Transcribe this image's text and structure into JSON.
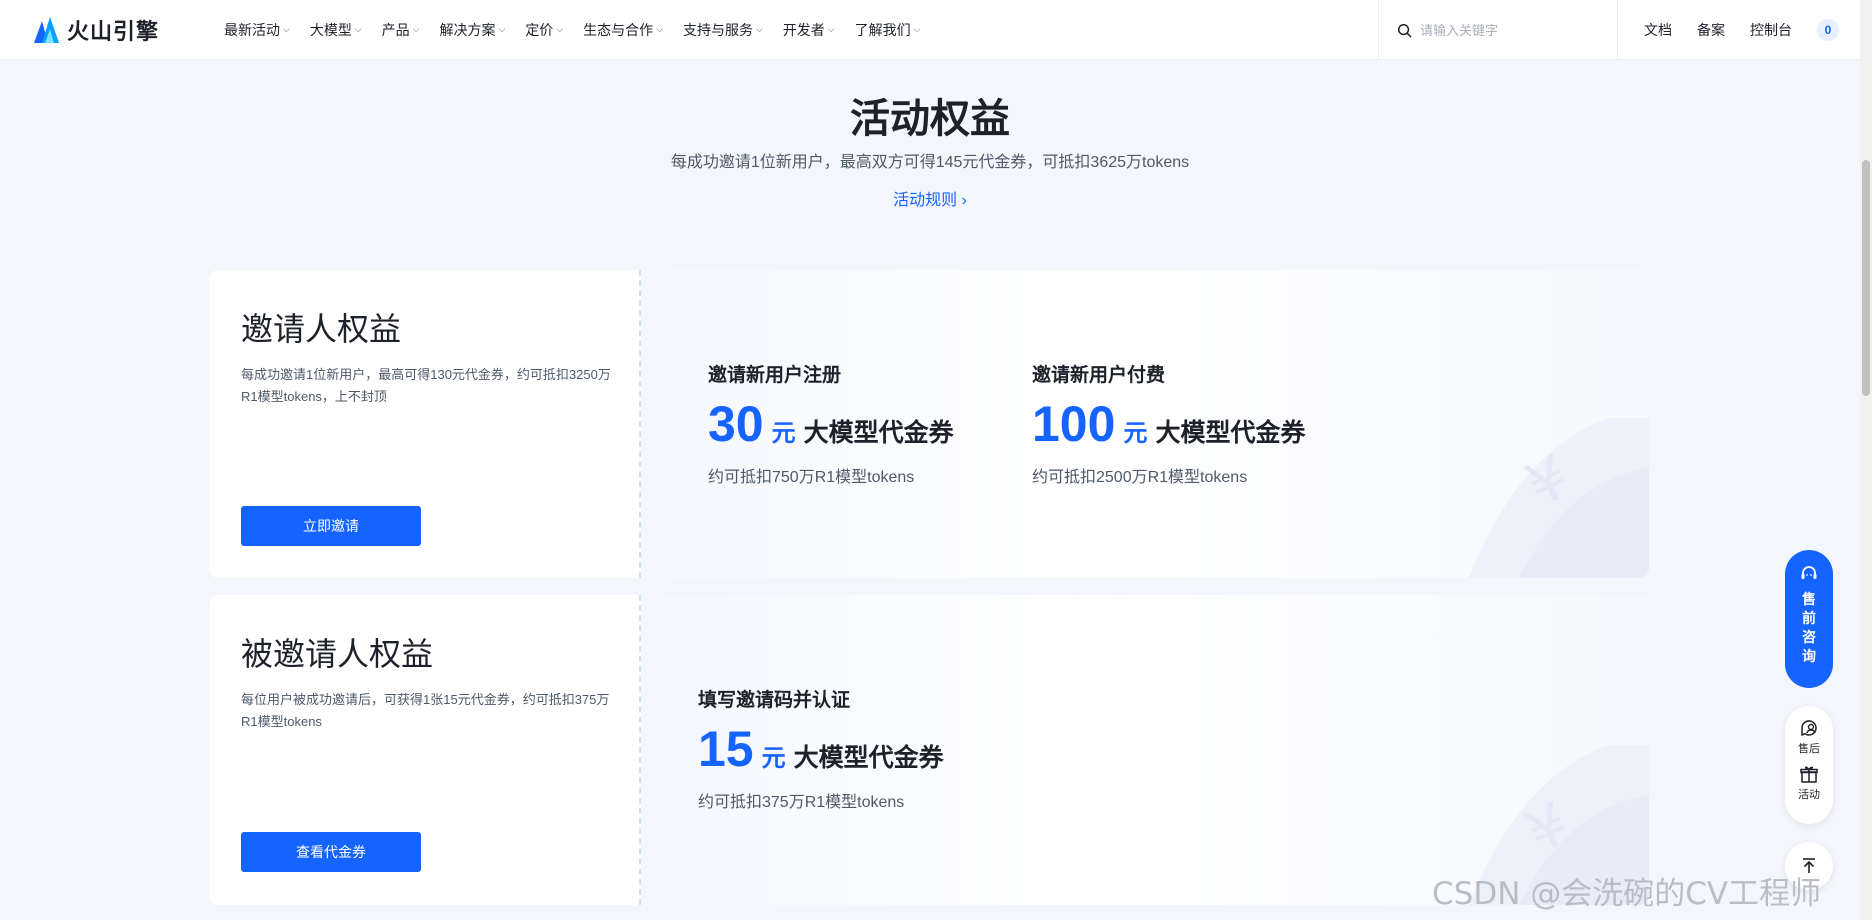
{
  "logo": {
    "text": "火山引擎"
  },
  "nav": [
    {
      "label": "最新活动"
    },
    {
      "label": "大模型"
    },
    {
      "label": "产品"
    },
    {
      "label": "解决方案"
    },
    {
      "label": "定价"
    },
    {
      "label": "生态与合作"
    },
    {
      "label": "支持与服务"
    },
    {
      "label": "开发者"
    },
    {
      "label": "了解我们"
    }
  ],
  "search": {
    "placeholder": "请输入关键字",
    "value": ""
  },
  "right_links": {
    "docs": "文档",
    "beian": "备案",
    "console": "控制台",
    "cart_count": "0"
  },
  "hero": {
    "title": "活动权益",
    "subtitle": "每成功邀请1位新用户，最高双方可得145元代金券，可抵扣3625万tokens",
    "rules_link": "活动规则"
  },
  "inviter_card": {
    "title": "邀请人权益",
    "desc": "每成功邀请1位新用户，最高可得130元代金券，约可抵扣3250万R1模型tokens，上不封顶",
    "button": "立即邀请",
    "benefits": [
      {
        "title": "邀请新用户注册",
        "amount": "30",
        "unit": "元",
        "name": "大模型代金券",
        "note": "约可抵扣750万R1模型tokens"
      },
      {
        "title": "邀请新用户付费",
        "amount": "100",
        "unit": "元",
        "name": "大模型代金券",
        "note": "约可抵扣2500万R1模型tokens"
      }
    ]
  },
  "invitee_card": {
    "title": "被邀请人权益",
    "desc": "每位用户被成功邀请后，可获得1张15元代金券，约可抵扣375万R1模型tokens",
    "button": "查看代金券",
    "benefits": [
      {
        "title": "填写邀请码并认证",
        "amount": "15",
        "unit": "元",
        "name": "大模型代金券",
        "note": "约可抵扣375万R1模型tokens"
      }
    ]
  },
  "float": {
    "consult": "售前咨询",
    "after_sales": "售后",
    "activity": "活动"
  },
  "watermark": "CSDN @会洗碗的CV工程师",
  "colors": {
    "accent": "#1664ff",
    "background": "#f3f6fb"
  }
}
